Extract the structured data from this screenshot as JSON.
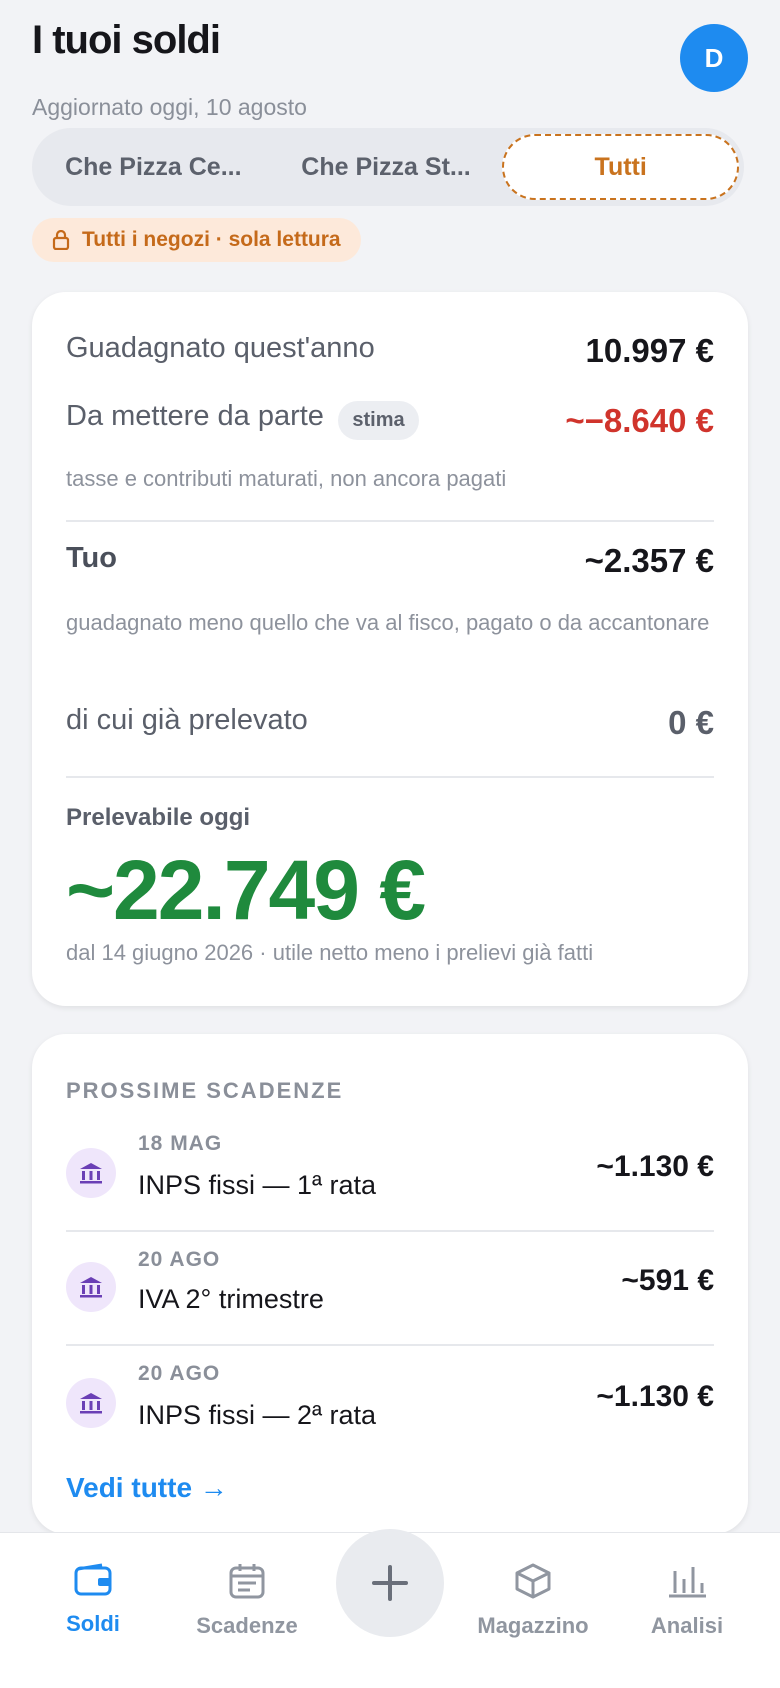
{
  "header": {
    "title": "I tuoi soldi",
    "subtitle": "Aggiornato oggi, 10 agosto",
    "avatar_initial": "D"
  },
  "stores": {
    "tabs": [
      {
        "label": "Che Pizza Ce..."
      },
      {
        "label": "Che Pizza St..."
      },
      {
        "label": "Tutti"
      }
    ],
    "selected": "Tutti",
    "readonly_note": "Tutti i negozi · sola lettura"
  },
  "summary": {
    "earned_label": "Guadagnato quest'anno",
    "earned_value": "10.997 €",
    "set_aside_label": "Da mettere da parte",
    "set_aside_badge": "stima",
    "set_aside_value": "~−8.640 €",
    "set_aside_note": "tasse e contributi maturati, non ancora pagati",
    "yours_label": "Tuo",
    "yours_value": "~2.357 €",
    "yours_note": "guadagnato meno quello che va al fisco, pagato o da accantonare",
    "withdrawn_label": "di cui già prelevato",
    "withdrawn_value": "0 €",
    "available_label": "Prelevabile oggi",
    "available_value": "~22.749 €",
    "available_note": "dal 14 giugno 2026 · utile netto meno i prelievi già fatti"
  },
  "deadlines": {
    "title": "PROSSIME SCADENZE",
    "items": [
      {
        "date": "18 MAG",
        "name": "INPS fissi — 1ª rata",
        "amount": "~1.130 €",
        "icon": "bank-icon"
      },
      {
        "date": "20 AGO",
        "name": "IVA 2° trimestre",
        "amount": "~591 €",
        "icon": "bank-icon"
      },
      {
        "date": "20 AGO",
        "name": "INPS fissi — 2ª rata",
        "amount": "~1.130 €",
        "icon": "bank-icon"
      }
    ],
    "see_all": "Vedi tutte →"
  },
  "tabbar": {
    "items": [
      {
        "label": "Soldi",
        "icon": "wallet-icon",
        "active": true
      },
      {
        "label": "Scadenze",
        "icon": "calendar-icon"
      },
      {
        "label": "Magazzino",
        "icon": "box-icon"
      },
      {
        "label": "Analisi",
        "icon": "bar-chart-icon"
      }
    ],
    "fab_icon": "plus-icon"
  },
  "colors": {
    "accent": "#1e8bf0",
    "warning": "#c9731e",
    "negative": "#d0342c",
    "positive": "#1f8a3d"
  }
}
